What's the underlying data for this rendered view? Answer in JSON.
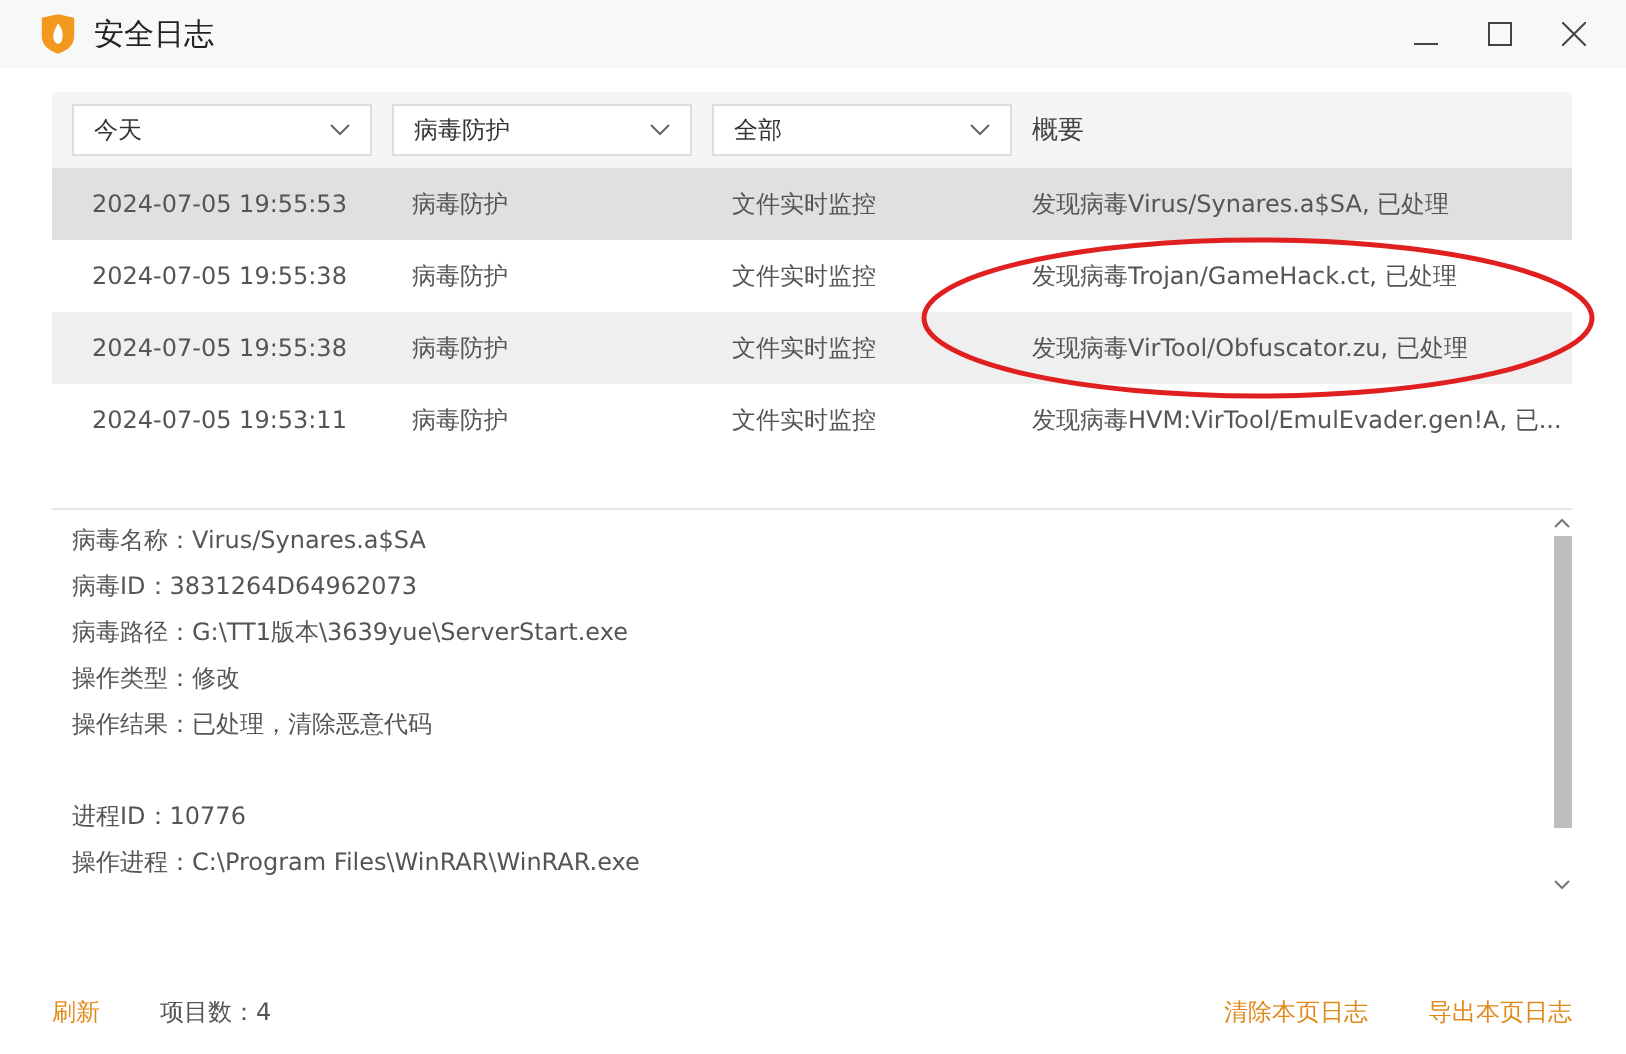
{
  "window": {
    "title": "安全日志"
  },
  "filters": [
    {
      "value": "今天"
    },
    {
      "value": "病毒防护"
    },
    {
      "value": "全部"
    }
  ],
  "summary_header": "概要",
  "rows": [
    {
      "time": "2024-07-05 19:55:53",
      "category": "病毒防护",
      "source": "文件实时监控",
      "summary": "发现病毒Virus/Synares.a$SA, 已处理",
      "selected": true
    },
    {
      "time": "2024-07-05 19:55:38",
      "category": "病毒防护",
      "source": "文件实时监控",
      "summary": "发现病毒Trojan/GameHack.ct, 已处理",
      "selected": false
    },
    {
      "time": "2024-07-05 19:55:38",
      "category": "病毒防护",
      "source": "文件实时监控",
      "summary": "发现病毒VirTool/Obfuscator.zu, 已处理",
      "selected": false
    },
    {
      "time": "2024-07-05 19:53:11",
      "category": "病毒防护",
      "source": "文件实时监控",
      "summary": "发现病毒HVM:VirTool/EmulEvader.gen!A, 已...",
      "selected": false
    }
  ],
  "details": [
    [
      "病毒名称：Virus/Synares.a$SA",
      "病毒ID：3831264D64962073",
      "病毒路径：G:\\TT1版本\\3639yue\\ServerStart.exe",
      "操作类型：修改",
      "操作结果：已处理，清除恶意代码"
    ],
    [
      "进程ID：10776",
      "操作进程：C:\\Program Files\\WinRAR\\WinRAR.exe"
    ]
  ],
  "footer": {
    "refresh": "刷新",
    "count": "项目数：4",
    "clear": "清除本页日志",
    "export": "导出本页日志"
  }
}
